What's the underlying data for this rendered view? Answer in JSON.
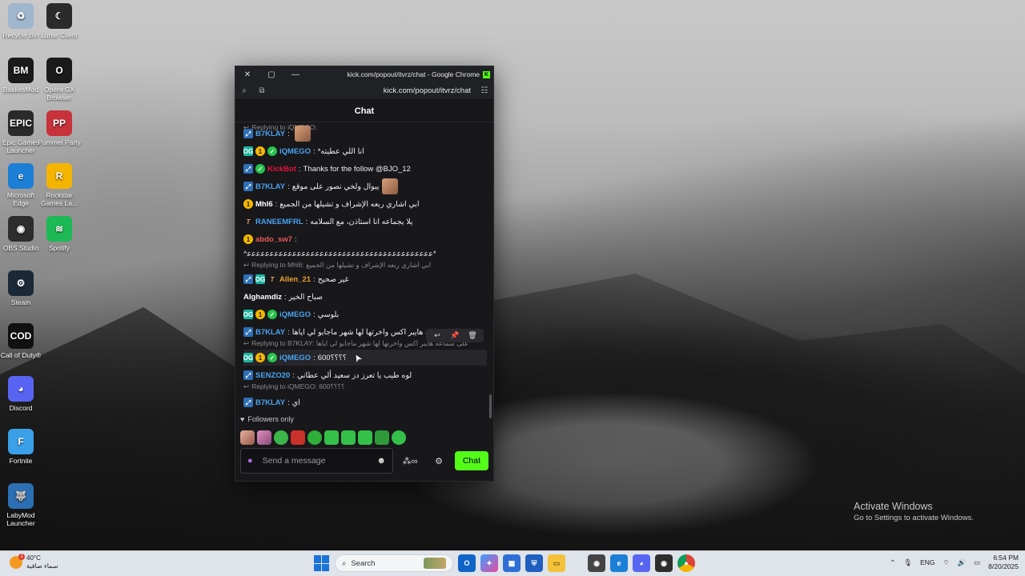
{
  "desktop": {
    "icons": [
      {
        "label": "Recycle Bin",
        "icon": "recycle-bin-icon",
        "color": "#9fb6cc",
        "glyph": "♻"
      },
      {
        "label": "Lunar Client",
        "icon": "lunar-client-icon",
        "color": "#2b2b2b",
        "glyph": "☾"
      },
      {
        "label": "BakkesMod",
        "icon": "bakkesmod-icon",
        "color": "#1a1a1a",
        "glyph": "BM"
      },
      {
        "label": "Opera GX Browser",
        "icon": "opera-gx-icon",
        "color": "#1a1a1a",
        "glyph": "O"
      },
      {
        "label": "Epic Games Launcher",
        "icon": "epic-games-icon",
        "color": "#2a2a2a",
        "glyph": "EPIC"
      },
      {
        "label": "Pummel Party",
        "icon": "pummel-party-icon",
        "color": "#c8323a",
        "glyph": "PP"
      },
      {
        "label": "Microsoft Edge",
        "icon": "edge-icon",
        "color": "#1c7fd6",
        "glyph": "e"
      },
      {
        "label": "Rockstar Games La...",
        "icon": "rockstar-icon",
        "color": "#f5b400",
        "glyph": "R"
      },
      {
        "label": "OBS Studio",
        "icon": "obs-icon",
        "color": "#2d2d2d",
        "glyph": "◉"
      },
      {
        "label": "Spotify",
        "icon": "spotify-icon",
        "color": "#1db954",
        "glyph": "≋"
      },
      {
        "label": "Steam",
        "icon": "steam-icon",
        "color": "#1b2838",
        "glyph": "⚙"
      },
      {
        "label": "Call of Duty®",
        "icon": "call-of-duty-icon",
        "color": "#111111",
        "glyph": "COD"
      },
      {
        "label": "Discord",
        "icon": "discord-icon",
        "color": "#5865f2",
        "glyph": "◕"
      },
      {
        "label": "Fortnite",
        "icon": "fortnite-icon",
        "color": "#3aa0e8",
        "glyph": "F"
      },
      {
        "label": "LabyMod Launcher",
        "icon": "labymod-icon",
        "color": "#2c6fb3",
        "glyph": "🐺"
      }
    ]
  },
  "window": {
    "title": "kick.com/popout/itvrz/chat - Google Chrome",
    "url": "kick.com/popout/itvrz/chat",
    "close": "✕",
    "maximize": "▢",
    "minimize": "—",
    "favicon": "K"
  },
  "chat": {
    "header": "Chat",
    "messages": [
      {
        "type": "reply",
        "text": "Replying to iQMEGO:"
      },
      {
        "user": "B7KLAY",
        "color": "#4aa3f0",
        "badges": [
          "sub"
        ],
        "text": "",
        "emote": true
      },
      {
        "user": "iQMEGO",
        "color": "#4aa3f0",
        "badges": [
          "og",
          "one",
          "ver"
        ],
        "text": "*انا اللي عطيته"
      },
      {
        "user": "KickBot",
        "color": "#e8123c",
        "badges": [
          "sub",
          "ver"
        ],
        "text": "Thanks for the follow @BJO_12"
      },
      {
        "user": "B7KLAY",
        "color": "#4aa3f0",
        "badges": [
          "sub"
        ],
        "text": "يبوال ولخي نصور على موقع",
        "emote": true
      },
      {
        "user": "Mhl6",
        "color": "#ffffff",
        "badges": [
          "one"
        ],
        "text": "ابي اشاري ربعه الإشراف و تشيلها من الجميع"
      },
      {
        "user": "RANEEMFRL",
        "color": "#4aa3f0",
        "badges": [
          "t"
        ],
        "text": "يلا يجماعه انا استاذن، مع السلامه"
      },
      {
        "user": "abdo_sw7",
        "color": "#e85a5a",
        "badges": [
          "one"
        ],
        "text": ""
      },
      {
        "type": "plain",
        "text": "^ﻋﻋﻋﻋﻋﻋﻋﻋﻋﻋﻋﻋﻋﻋﻋﻋﻋﻋﻋﻋﻋﻋﻋﻋﻋﻋﻋﻋﻋﻋﻋﻋﻋﻋﻋﻋﻋﻋﻋﻋﻋ*"
      },
      {
        "type": "reply",
        "text": "Replying to Mhl6: ابي اشاري ربعه الإشراف و تشيلها من الجميع"
      },
      {
        "user": "Allen_21",
        "color": "#f0a030",
        "badges": [
          "sub",
          "og",
          "t"
        ],
        "text": "غير صحيح"
      },
      {
        "user": "Alghamdiz",
        "color": "#ffffff",
        "badges": [],
        "text": "صباح الخير"
      },
      {
        "user": "iQMEGO",
        "color": "#4aa3f0",
        "badges": [
          "og",
          "one",
          "ver"
        ],
        "text": "بلوسي"
      },
      {
        "user": "B7KLAY",
        "color": "#4aa3f0",
        "badges": [
          "sub"
        ],
        "text": "على سماعه هايبر اكس واخرتها لها شهر ماجابو لي اياها"
      },
      {
        "type": "reply",
        "text": "Replying to B7KLAY: على سماعه هايبر اكس واخرتها لها شهر ماجابو لي اياها"
      },
      {
        "user": "iQMEGO",
        "color": "#4aa3f0",
        "badges": [
          "og",
          "one",
          "ver"
        ],
        "text": "600؟؟؟؟",
        "highlight": true
      },
      {
        "user": "SENZO20",
        "color": "#4aa3f0",
        "badges": [
          "sub"
        ],
        "text": "لوه طيب يا تعرز دز سعيد ألي عطاني"
      },
      {
        "type": "reply",
        "text": "Replying to iQMEGO: 600؟؟؟؟"
      },
      {
        "user": "B7KLAY",
        "color": "#4aa3f0",
        "badges": [
          "sub"
        ],
        "text": "اي"
      }
    ],
    "hover_tools": [
      "↩",
      "📌",
      "🗑"
    ],
    "followers_only": "Followers only",
    "input_placeholder": "Send a message",
    "send_label": "Chat",
    "accent": "#53fc18"
  },
  "activate": {
    "title": "Activate Windows",
    "subtitle": "Go to Settings to activate Windows."
  },
  "taskbar": {
    "temperature": "40°C",
    "weather_text": "سماء صافية",
    "search_label": "Search",
    "language": "ENG",
    "time": "6:54 PM",
    "date": "8/20/2025"
  }
}
